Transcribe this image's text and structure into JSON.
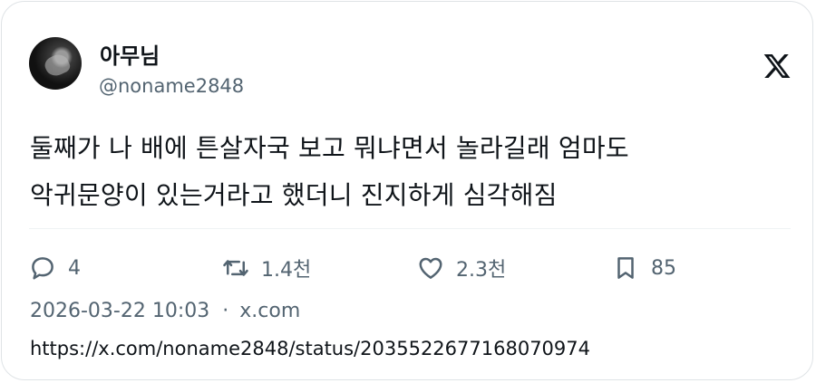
{
  "author": {
    "display_name": "아무님",
    "handle": "@noname2848",
    "avatar_icon": "avatar-photo"
  },
  "brand": {
    "icon": "x-logo-icon",
    "color": "#0f1419"
  },
  "tweet": {
    "lines": [
      "둘째가 나 배에 튼살자국 보고 뭐냐면서 놀라길래 엄마도",
      "악귀문양이 있는거라고 했더니 진지하게 심각해짐"
    ]
  },
  "actions": {
    "reply": {
      "icon": "reply-icon",
      "count": "4"
    },
    "retweet": {
      "icon": "retweet-icon",
      "count": "1.4천"
    },
    "like": {
      "icon": "heart-icon",
      "count": "2.3천"
    },
    "bookmark": {
      "icon": "bookmark-icon",
      "count": "85"
    }
  },
  "meta": {
    "timestamp": "2026-03-22 10:03",
    "separator": "·",
    "source": "x.com"
  },
  "url": "https://x.com/noname2848/status/2035522677168070974",
  "colors": {
    "secondary_text": "#536471",
    "border": "#dfe3e6"
  }
}
